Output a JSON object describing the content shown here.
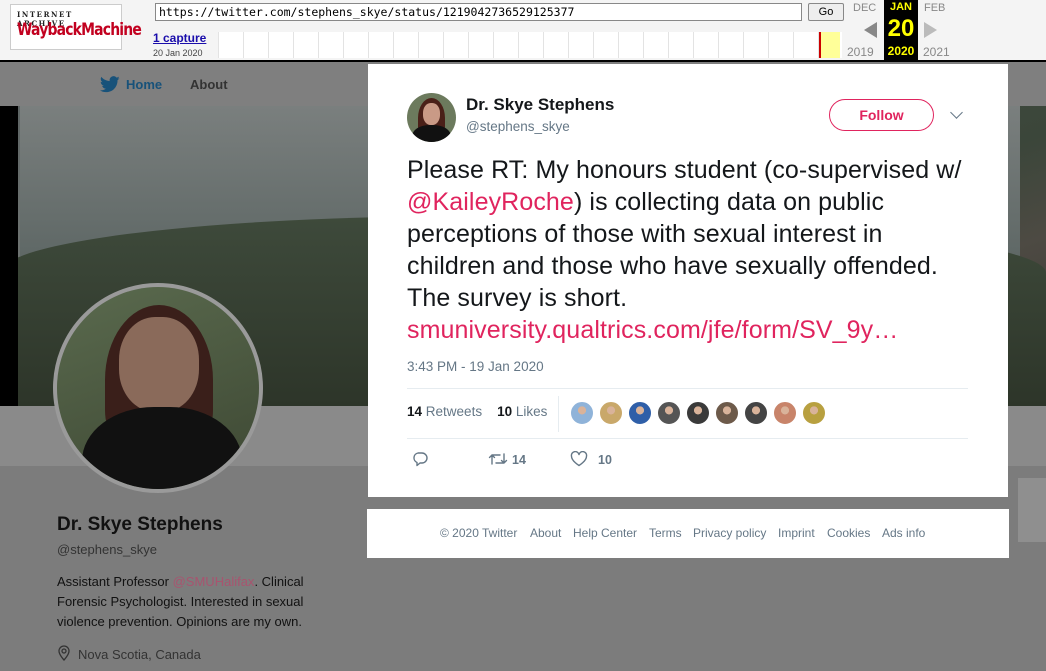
{
  "wayback": {
    "logo_top": "INTERNET ARCHIVE",
    "logo_main": "WaybackMachine",
    "url": "https://twitter.com/stephens_skye/status/1219042736529125377",
    "go_label": "Go",
    "captures_link": "1 capture",
    "capture_date": "20 Jan 2020",
    "prev_month": "DEC",
    "cur_month": "JAN",
    "next_month": "FEB",
    "cur_day": "20",
    "prev_year": "2019",
    "cur_year": "2020",
    "next_year": "2021"
  },
  "nav": {
    "home_label": "Home",
    "about_label": "About"
  },
  "profile": {
    "name": "Dr. Skye Stephens",
    "handle": "@stephens_skye",
    "bio_pre": "Assistant Professor ",
    "bio_mention": "@SMUHalifax",
    "bio_post": ". Clinical Forensic Psychologist. Interested in sexual violence prevention. Opinions are my own.",
    "location": "Nova Scotia, Canada"
  },
  "tweet": {
    "author_name": "Dr. Skye Stephens",
    "author_handle": "@stephens_skye",
    "follow_label": "Follow",
    "text_part1": "Please RT: My honours student (co-supervised w/ ",
    "mention": "@KaileyRoche",
    "text_part2": ") is collecting data on public perceptions of those with sexual interest in children and those who have sexually offended. The survey is short. ",
    "link": "smuniversity.qualtrics.com/jfe/form/SV_9y…",
    "timestamp": "3:43 PM - 19 Jan 2020",
    "retweet_count": "14",
    "retweet_label": "Retweets",
    "like_count": "10",
    "like_label": "Likes",
    "action_retweet_count": "14",
    "action_like_count": "10",
    "liker_colors": [
      "#8fb3d9",
      "#c9a86a",
      "#2f5fa8",
      "#555555",
      "#3a3a3a",
      "#6d5a4a",
      "#444444",
      "#c8846a",
      "#b8a040"
    ]
  },
  "footer": {
    "copyright": "© 2020 Twitter",
    "links": [
      "About",
      "Help Center",
      "Terms",
      "Privacy policy",
      "Imprint",
      "Cookies",
      "Ads info"
    ]
  },
  "colors": {
    "accent": "#e0245e",
    "secondary_text": "#657786"
  },
  "icons": [
    "twitter-bird-icon",
    "caret-down-icon",
    "reply-icon",
    "retweet-icon",
    "heart-icon",
    "location-pin-icon"
  ]
}
